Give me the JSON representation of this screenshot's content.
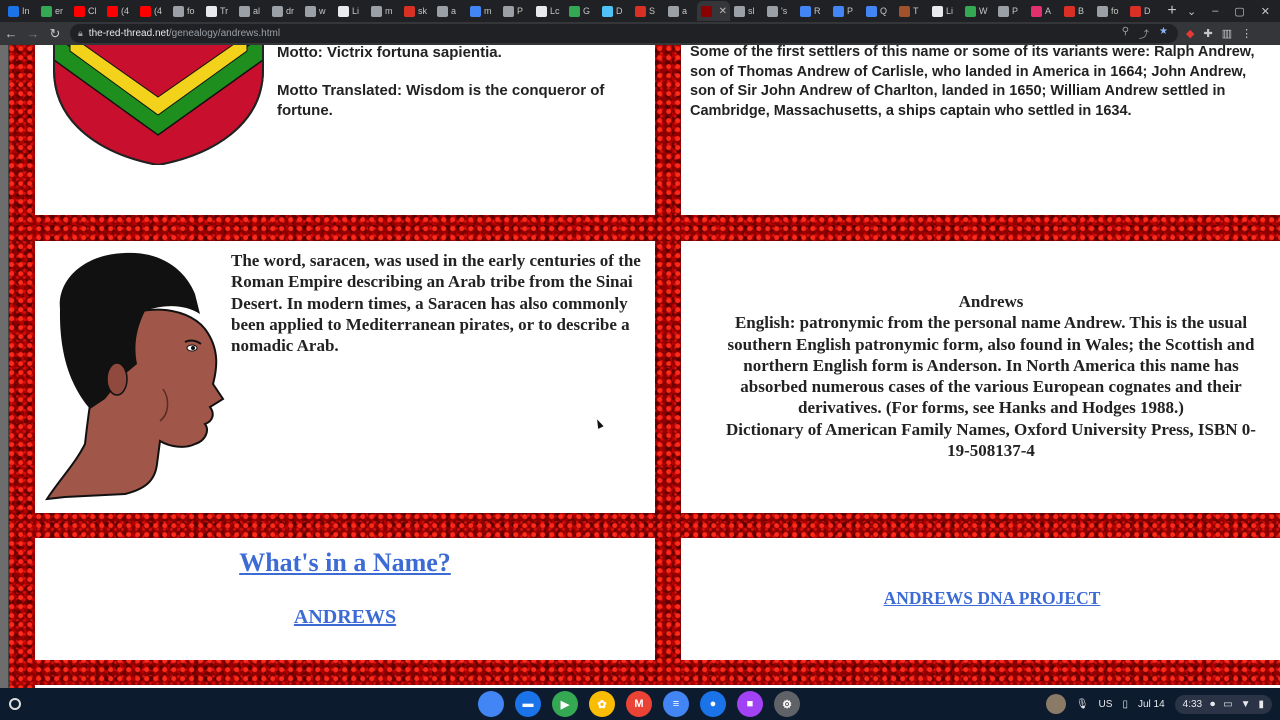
{
  "browser": {
    "tabs": [
      {
        "label": "In",
        "color": "#1a73e8"
      },
      {
        "label": "er",
        "color": "#34a853"
      },
      {
        "label": "Cl",
        "color": "#ff0000"
      },
      {
        "label": "(4",
        "color": "#ff0000"
      },
      {
        "label": "(4",
        "color": "#ff0000"
      },
      {
        "label": "fo",
        "color": "#9aa0a6"
      },
      {
        "label": "Tr",
        "color": "#e8eaed"
      },
      {
        "label": "al",
        "color": "#9aa0a6"
      },
      {
        "label": "dr",
        "color": "#9aa0a6"
      },
      {
        "label": "w",
        "color": "#9aa0a6"
      },
      {
        "label": "Li",
        "color": "#e8eaed"
      },
      {
        "label": "m",
        "color": "#9aa0a6"
      },
      {
        "label": "sk",
        "color": "#d93025"
      },
      {
        "label": "a",
        "color": "#9aa0a6"
      },
      {
        "label": "m",
        "color": "#4285f4"
      },
      {
        "label": "P",
        "color": "#9aa0a6"
      },
      {
        "label": "Lc",
        "color": "#e8eaed"
      },
      {
        "label": "G",
        "color": "#34a853"
      },
      {
        "label": "D",
        "color": "#4fc3f7"
      },
      {
        "label": "S",
        "color": "#d93025"
      },
      {
        "label": "a",
        "color": "#9aa0a6"
      },
      {
        "label": "",
        "color": "#8b0000",
        "active": true
      },
      {
        "label": "sl",
        "color": "#9aa0a6"
      },
      {
        "label": "'s",
        "color": "#9aa0a6"
      },
      {
        "label": "R",
        "color": "#4285f4"
      },
      {
        "label": "P",
        "color": "#4285f4"
      },
      {
        "label": "Q",
        "color": "#4285f4"
      },
      {
        "label": "T",
        "color": "#a0522d"
      },
      {
        "label": "Li",
        "color": "#e8eaed"
      },
      {
        "label": "W",
        "color": "#34a853"
      },
      {
        "label": "P",
        "color": "#9aa0a6"
      },
      {
        "label": "A",
        "color": "#e1306c"
      },
      {
        "label": "B",
        "color": "#d93025"
      },
      {
        "label": "fo",
        "color": "#9aa0a6"
      },
      {
        "label": "D",
        "color": "#d93025"
      }
    ],
    "address": {
      "host": "the-red-thread.net",
      "path": "/genealogy/andrews.html"
    }
  },
  "page": {
    "motto": "Motto: Victrix fortuna sapientia.",
    "motto_translated": "Motto Translated: Wisdom is the conqueror of fortune.",
    "settlers": "Some of the first settlers of this name or some of its variants were: Ralph Andrew, son of Thomas Andrew of Carlisle, who landed in America in 1664; John Andrew, son of Sir John Andrew of Charlton, landed in 1650; William Andrew settled in Cambridge, Massachusetts, a ships captain who settled in 1634.",
    "saracen": "The word, saracen, was used in the early centuries of the Roman Empire describing an Arab tribe from the Sinai Desert. In modern times, a Saracen has also commonly been applied to Mediterranean pirates, or to describe a nomadic Arab.",
    "definition_lines": [
      "Andrews",
      "English: patronymic from the personal name Andrew. This is the usual",
      "southern English patronymic form, also found in Wales; the Scottish and",
      "northern English form is Anderson. In North America this name has",
      "absorbed numerous cases of the various European cognates and their",
      "derivatives. (For forms, see Hanks and Hodges 1988.)",
      "Dictionary of American Family Names, Oxford University Press, ISBN 0-",
      "19-508137-4"
    ],
    "whats_in_a_name": "What's in a Name?",
    "andrews_link": "ANDREWS",
    "dna_project": "ANDREWS DNA PROJECT"
  },
  "shelf": {
    "apps": [
      {
        "name": "chrome",
        "color": "#4285f4",
        "glyph": ""
      },
      {
        "name": "files",
        "color": "#1a73e8",
        "glyph": "▬"
      },
      {
        "name": "play-store",
        "color": "#34a853",
        "glyph": "▶"
      },
      {
        "name": "photos",
        "color": "#fbbc04",
        "glyph": "✿"
      },
      {
        "name": "gmail",
        "color": "#ea4335",
        "glyph": "M"
      },
      {
        "name": "docs",
        "color": "#4285f4",
        "glyph": "≡"
      },
      {
        "name": "chat",
        "color": "#1a73e8",
        "glyph": "●"
      },
      {
        "name": "screencast",
        "color": "#a142f4",
        "glyph": "■"
      },
      {
        "name": "settings",
        "color": "#5f6368",
        "glyph": "⚙"
      }
    ],
    "keyboard": "US",
    "date": "Jul 14",
    "time": "4:33"
  }
}
